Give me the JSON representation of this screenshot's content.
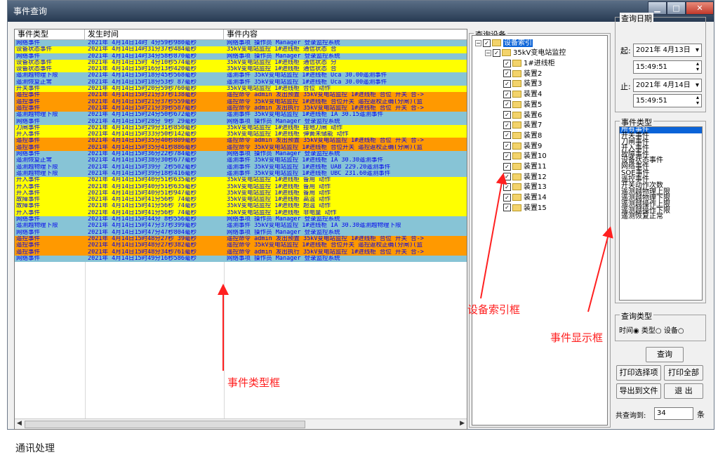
{
  "window": {
    "title": "事件查询",
    "minimize_icon": "minimize-icon",
    "maximize_icon": "maximize-icon",
    "close_icon": "close-icon"
  },
  "event_table": {
    "headers": [
      "事件类型",
      "发生时间",
      "事件内容"
    ],
    "colors": {
      "cyan": "#87c4d6",
      "yellow": "#ffff00",
      "orange": "#ff9900"
    },
    "rows": [
      {
        "type": "网络事件",
        "time": "2021年 4月14日14时 4分59秒980毫秒",
        "content": "网络事项 操作员 Manager 登录监控系统",
        "color": "cyan"
      },
      {
        "type": "设备状态事件",
        "time": "2021年 4月14日14时31分37秒484毫秒",
        "content": "35kV变电站监控 1#进线柜 通信状态 合",
        "color": "yellow"
      },
      {
        "type": "网络事件",
        "time": "2021年 4月14日14时34分58秒870毫秒",
        "content": "网络事项 操作员 Manager 登录监控系统",
        "color": "cyan"
      },
      {
        "type": "设备状态事件",
        "time": "2021年 4月14日15时 4分10秒574毫秒",
        "content": "35kV变电站监控 1#进线柜 通信状态 分",
        "color": "yellow"
      },
      {
        "type": "设备状态事件",
        "time": "2021年 4月14日15时16分13秒420毫秒",
        "content": "35kV变电站监控 1#进线柜 通信状态 合",
        "color": "yellow"
      },
      {
        "type": "遥测越物理下限",
        "time": "2021年 4月14日15时18分45秒568毫秒",
        "content": "遥测事件 35kV变电站监控 1#进线柜 Uca 30.00遥测事件",
        "color": "cyan"
      },
      {
        "type": "遥测恢复正常",
        "time": "2021年 4月14日15时18分53秒 87毫秒",
        "content": "遥测事件 35kV变电站监控 1#进线柜 Uca 30.00遥测事件",
        "color": "cyan"
      },
      {
        "type": "开关事件",
        "time": "2021年 4月14日15时20分59秒760毫秒",
        "content": "35kV变电站监控 1#进线柜 合位 动作",
        "color": "yellow"
      },
      {
        "type": "遥控事件",
        "time": "2021年 4月14日15时21分37秒138毫秒",
        "content": "遥控命令 admin 发出预置 35kV变电站监控 1#进线柜 合位 开关 合->",
        "color": "orange"
      },
      {
        "type": "遥控事件",
        "time": "2021年 4月14日15时21分37秒559毫秒",
        "content": "遥控命令 35kV变电站监控 1#进线柜 合位开关 遥控返校正确(分闸)(监",
        "color": "orange"
      },
      {
        "type": "遥控事件",
        "time": "2021年 4月14日15时21分39秒587毫秒",
        "content": "遥控命令 admin 发出执行 35kV变电站监控 1#进线柜 合位 开关 合->",
        "color": "orange"
      },
      {
        "type": "遥测越物理下限",
        "time": "2021年 4月14日15时24分50秒672毫秒",
        "content": "遥测事件 35kV变电站监控 1#进线柜 IA 30.15遥测事件",
        "color": "cyan"
      },
      {
        "type": "网络事件",
        "time": "2021年 4月14日15时28分 9秒 29毫秒",
        "content": "网络事项 操作员 Manager 登录监控系统",
        "color": "cyan"
      },
      {
        "type": "刀闸事件",
        "time": "2021年 4月14日15时29分31秒850毫秒",
        "content": "35kV变电站监控 1#进线柜 接地刀闸 动作",
        "color": "yellow"
      },
      {
        "type": "开入事件",
        "time": "2021年 4月14日15时33分50秒142毫秒",
        "content": "35kV变电站监控 1#进线柜 弹簧未储能 动作",
        "color": "yellow"
      },
      {
        "type": "遥控事件",
        "time": "2021年 4月14日15时35分40秒809毫秒",
        "content": "遥控命令 admin 发出预置 35kV变电站监控 1#进线柜 合位 开关 合->",
        "color": "orange"
      },
      {
        "type": "遥控事件",
        "time": "2021年 4月14日15时35分41秒886毫秒",
        "content": "遥控命令 35kV变电站监控 1#进线柜 合位开关 遥控返校正确(分闸)(监",
        "color": "orange"
      },
      {
        "type": "网络事件",
        "time": "2021年 4月14日15时36分22秒784毫秒",
        "content": "网络事项 操作员 Manager 登录监控系统",
        "color": "cyan"
      },
      {
        "type": "遥测恢复正常",
        "time": "2021年 4月14日15时38分30秒677毫秒",
        "content": "遥测事件 35kV变电站监控 1#进线柜 IA 30.30遥测事件",
        "color": "cyan"
      },
      {
        "type": "遥测越物理下限",
        "time": "2021年 4月14日15时39分 2秒502毫秒",
        "content": "遥测事件 35kV变电站监控 1#进线柜 UAB 229.20遥测事件",
        "color": "cyan"
      },
      {
        "type": "遥测越物理下限",
        "time": "2021年 4月14日15时39分18秒416毫秒",
        "content": "遥测事件 35kV变电站监控 1#进线柜 UBC 231.60遥测事件",
        "color": "cyan"
      },
      {
        "type": "开入事件",
        "time": "2021年 4月14日15时40分51秒635毫秒",
        "content": "35kV变电站监控 1#进线柜 备用 动作",
        "color": "yellow"
      },
      {
        "type": "开入事件",
        "time": "2021年 4月14日15时40分51秒635毫秒",
        "content": "35kV变电站监控 1#进线柜 备用 动作",
        "color": "yellow"
      },
      {
        "type": "开入事件",
        "time": "2021年 4月14日15时40分51秒947毫秒",
        "content": "35kV变电站监控 1#进线柜 备用 动作",
        "color": "yellow"
      },
      {
        "type": "故障事件",
        "time": "2021年 4月14日15时41分56秒 74毫秒",
        "content": "35kV变电站监控 1#进线柜 高温 动作",
        "color": "yellow"
      },
      {
        "type": "故障事件",
        "time": "2021年 4月14日15时41分56秒 74毫秒",
        "content": "35kV变电站监控 1#进线柜 超温 动作",
        "color": "yellow"
      },
      {
        "type": "开入事件",
        "time": "2021年 4月14日15时41分56秒 74毫秒",
        "content": "35kV变电站监控 1#进线柜 非电量 动作",
        "color": "yellow"
      },
      {
        "type": "网络事件",
        "time": "2021年 4月14日15时44分 8秒556毫秒",
        "content": "网络事项 操作员 Manager 登录监控系统",
        "color": "cyan"
      },
      {
        "type": "遥测越物理下限",
        "time": "2021年 4月14日15时47分37秒399毫秒",
        "content": "遥测事件 35kV变电站监控 1#进线柜 IA 30.30遥测越物理下限",
        "color": "cyan"
      },
      {
        "type": "网络事件",
        "time": "2021年 4月14日15时47分47秒804毫秒",
        "content": "网络事项 操作员 Manager 登录监控系统",
        "color": "cyan"
      },
      {
        "type": "遥控事件",
        "time": "2021年 4月14日15时48分27秒 39毫秒",
        "content": "遥控命令 admin 发出预置 35kV变电站监控 1#进线柜 合位 开关 合->",
        "color": "orange"
      },
      {
        "type": "遥控事件",
        "time": "2021年 4月14日15时48分27秒382毫秒",
        "content": "遥控命令 35kV变电站监控 1#进线柜 合位开关 遥控返校正确(分闸)(监",
        "color": "orange"
      },
      {
        "type": "遥控事件",
        "time": "2021年 4月14日15时48分34秒761毫秒",
        "content": "遥控命令 admin 发出执行 35kV变电站监控 1#进线柜 合位 开关 合->",
        "color": "orange"
      },
      {
        "type": "网络事件",
        "time": "2021年 4月14日15时49分16秒586毫秒",
        "content": "网络事项 操作员 Manager 登录监控系统",
        "color": "cyan"
      }
    ]
  },
  "device_panel": {
    "label": "查询设备",
    "root": "设备索引",
    "station": "35kV变电站监控",
    "devices": [
      "1#进线柜",
      "装置2",
      "装置3",
      "装置4",
      "装置5",
      "装置6",
      "装置7",
      "装置8",
      "装置9",
      "装置10",
      "装置11",
      "装置12",
      "装置13",
      "装置14",
      "装置15"
    ]
  },
  "date_panel": {
    "label": "查询日期",
    "start_label": "起:",
    "start_date": "2021年 4月13日",
    "start_time": "15:49:51",
    "end_label": "止:",
    "end_date": "2021年 4月14日",
    "end_time": "15:49:51"
  },
  "event_type_panel": {
    "label": "事件类型",
    "items": [
      "所有事件",
      "开关事件",
      "刀闸事件",
      "开入事件",
      "故障事件",
      "设备状态事件",
      "网络事件",
      "SOE事件",
      "遥控事件",
      "开关动作次数",
      "遥测越物理上限",
      "遥测越物理下限",
      "遥测越操作上限",
      "遥测越操作下限",
      "遥测恢复正常"
    ]
  },
  "query_type": {
    "label": "查询类型",
    "options": [
      "时间",
      "类型",
      "设备"
    ]
  },
  "buttons": {
    "query": "查询",
    "print_selected": "打印选择项",
    "print_all": "打印全部",
    "export": "导出到文件",
    "exit": "退 出"
  },
  "total": {
    "prefix": "共查询到:",
    "count": "34",
    "unit": "条"
  },
  "annotations": {
    "type_box": "事件类型框",
    "device_box": "设备索引框",
    "event_box": "事件显示框",
    "color": "#ff2020"
  },
  "bottom_text": "通讯处理"
}
